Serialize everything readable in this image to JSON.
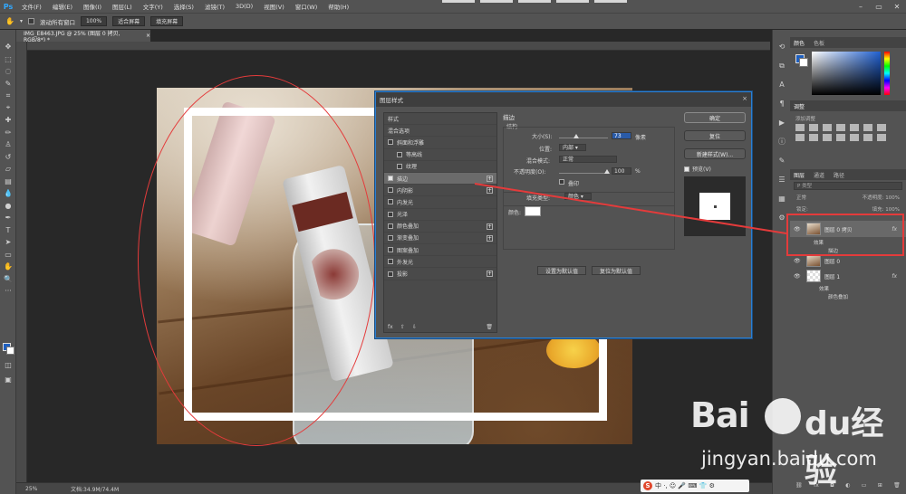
{
  "app": {
    "logo": "Ps"
  },
  "menu": [
    "文件(F)",
    "编辑(E)",
    "图像(I)",
    "图层(L)",
    "文字(Y)",
    "选择(S)",
    "滤镜(T)",
    "3D(D)",
    "视图(V)",
    "窗口(W)",
    "帮助(H)"
  ],
  "options": {
    "scroll_all": "滚动所有窗口",
    "zoom": "100%",
    "fit_screen": "适合屏幕",
    "fill_screen": "填充屏幕"
  },
  "document": {
    "tab_title": "IMG_E8463.JPG @ 25% (图层 0 拷贝, RGB/8*) *",
    "close": "×"
  },
  "status": {
    "zoom": "25%",
    "doc_size": "文档:34.9M/74.4M"
  },
  "dialog": {
    "title": "图层样式",
    "close": "×",
    "styles_header": "样式",
    "blend_options": "混合选项",
    "effects": [
      {
        "label": "斜面和浮雕",
        "checked": false,
        "plus": false,
        "sub": false
      },
      {
        "label": "等高线",
        "checked": false,
        "plus": false,
        "sub": true
      },
      {
        "label": "纹理",
        "checked": false,
        "plus": false,
        "sub": true
      },
      {
        "label": "描边",
        "checked": true,
        "plus": true,
        "sub": false,
        "selected": true
      },
      {
        "label": "内阴影",
        "checked": false,
        "plus": true,
        "sub": false
      },
      {
        "label": "内发光",
        "checked": false,
        "plus": false,
        "sub": false
      },
      {
        "label": "光泽",
        "checked": false,
        "plus": false,
        "sub": false
      },
      {
        "label": "颜色叠加",
        "checked": false,
        "plus": true,
        "sub": false
      },
      {
        "label": "渐变叠加",
        "checked": false,
        "plus": true,
        "sub": false
      },
      {
        "label": "图案叠加",
        "checked": false,
        "plus": false,
        "sub": false
      },
      {
        "label": "外发光",
        "checked": false,
        "plus": false,
        "sub": false
      },
      {
        "label": "投影",
        "checked": false,
        "plus": true,
        "sub": false
      }
    ],
    "footer": {
      "fx": "fx",
      "up": "⇧",
      "down": "⇩",
      "trash": "🗑"
    },
    "stroke": {
      "header": "描边",
      "structure": "结构",
      "size_label": "大小(S):",
      "size_value": "73",
      "size_unit": "像素",
      "position_label": "位置:",
      "position_value": "内部",
      "blend_label": "混合模式:",
      "blend_value": "正常",
      "opacity_label": "不透明度(O):",
      "opacity_value": "100",
      "opacity_unit": "%",
      "overprint_label": "叠印",
      "fill_type_label": "填充类型:",
      "fill_type_value": "颜色",
      "color_label": "颜色:",
      "set_default": "设置为默认值",
      "reset_default": "复位为默认值"
    },
    "buttons": {
      "ok": "确定",
      "reset": "复位",
      "new_style": "新建样式(W)...",
      "preview": "预览(V)"
    }
  },
  "panels": {
    "color_tabs": [
      "颜色",
      "色板"
    ],
    "adjust_tabs": [
      "调整"
    ],
    "adjust_add": "添加调整",
    "layer_tabs": [
      "图层",
      "通道",
      "路径"
    ],
    "layer_search": "P 类型",
    "layer_mode": "正常",
    "layer_opacity": "不透明度: 100%",
    "layer_lock": "锁定:",
    "layer_fill": "填充: 100%"
  },
  "layers": [
    {
      "name": "图层 0 拷贝",
      "fx": true,
      "selected": true,
      "effects_label": "效果",
      "effects": [
        "描边"
      ]
    },
    {
      "name": "图层 0",
      "fx": false,
      "selected": false
    },
    {
      "name": "图层 1",
      "fx": true,
      "selected": false,
      "effects_label": "效果",
      "effects": [
        "颜色叠加"
      ]
    }
  ],
  "watermark": {
    "brand": "Bai",
    "brand2": "du",
    "cn": "经验",
    "url": "jingyan.baidu.com"
  },
  "ime": {
    "s": "S",
    "text": "中 ·, ☺ 🎤 ⌨ 👕 ⚙"
  }
}
